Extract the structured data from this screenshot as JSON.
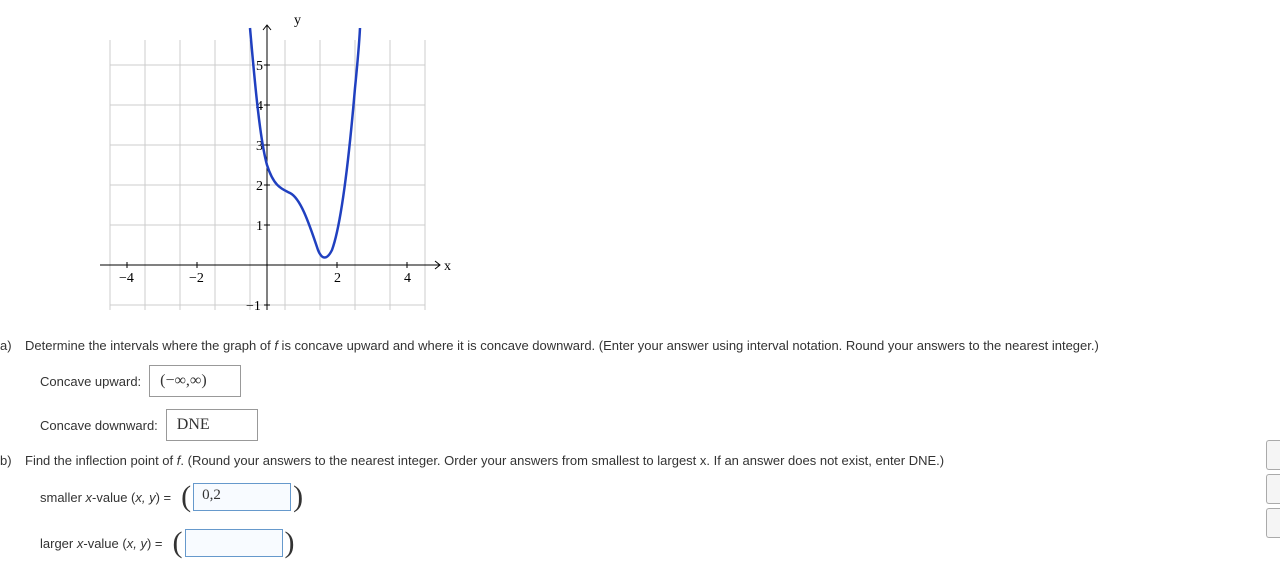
{
  "chart_data": {
    "type": "line",
    "title": "",
    "xlabel": "x",
    "ylabel": "y",
    "xlim": [
      -5,
      5
    ],
    "ylim": [
      -1.5,
      5.5
    ],
    "x_ticks": [
      -4,
      -2,
      2,
      4
    ],
    "y_ticks": [
      -1,
      1,
      2,
      3,
      4,
      5
    ],
    "series": [
      {
        "name": "f",
        "points": [
          [
            -0.5,
            6
          ],
          [
            -0.3,
            4.5
          ],
          [
            -0.1,
            3.2
          ],
          [
            0,
            2.5
          ],
          [
            0.1,
            2.1
          ],
          [
            0.3,
            1.9
          ],
          [
            0.5,
            1.8
          ],
          [
            0.8,
            1.6
          ],
          [
            1.1,
            1.0
          ],
          [
            1.4,
            0.4
          ],
          [
            1.6,
            0.25
          ],
          [
            1.8,
            0.5
          ],
          [
            2.0,
            1.2
          ],
          [
            2.2,
            2.4
          ],
          [
            2.4,
            4.2
          ],
          [
            2.5,
            5.5
          ],
          [
            2.6,
            6
          ]
        ]
      }
    ]
  },
  "part_a": {
    "label": "a)",
    "text_1": "Determine the intervals where the graph of ",
    "f": "f",
    "text_2": " is concave upward and where it is concave downward. (Enter your answer using interval notation. Round your answers to the nearest integer.)",
    "concave_up_label": "Concave upward:",
    "concave_up_value": "(−∞,∞)",
    "concave_down_label": "Concave downward:",
    "concave_down_value": "DNE"
  },
  "part_b": {
    "label": "b)",
    "text_1": "Find the inflection point of ",
    "f": "f",
    "text_2": ". (Round your answers to the nearest integer. Order your answers from smallest to largest x. If an answer does not exist, enter DNE.)",
    "smaller_label_1": "smaller ",
    "smaller_label_x": "x",
    "smaller_label_2": "-value (",
    "smaller_label_xy": "x, y",
    "smaller_label_3": ")  =",
    "smaller_value": "0,2",
    "larger_label_1": "larger ",
    "larger_label_x": "x",
    "larger_label_2": "-value (",
    "larger_label_xy": "x, y",
    "larger_label_3": ")  =",
    "larger_value": ""
  }
}
